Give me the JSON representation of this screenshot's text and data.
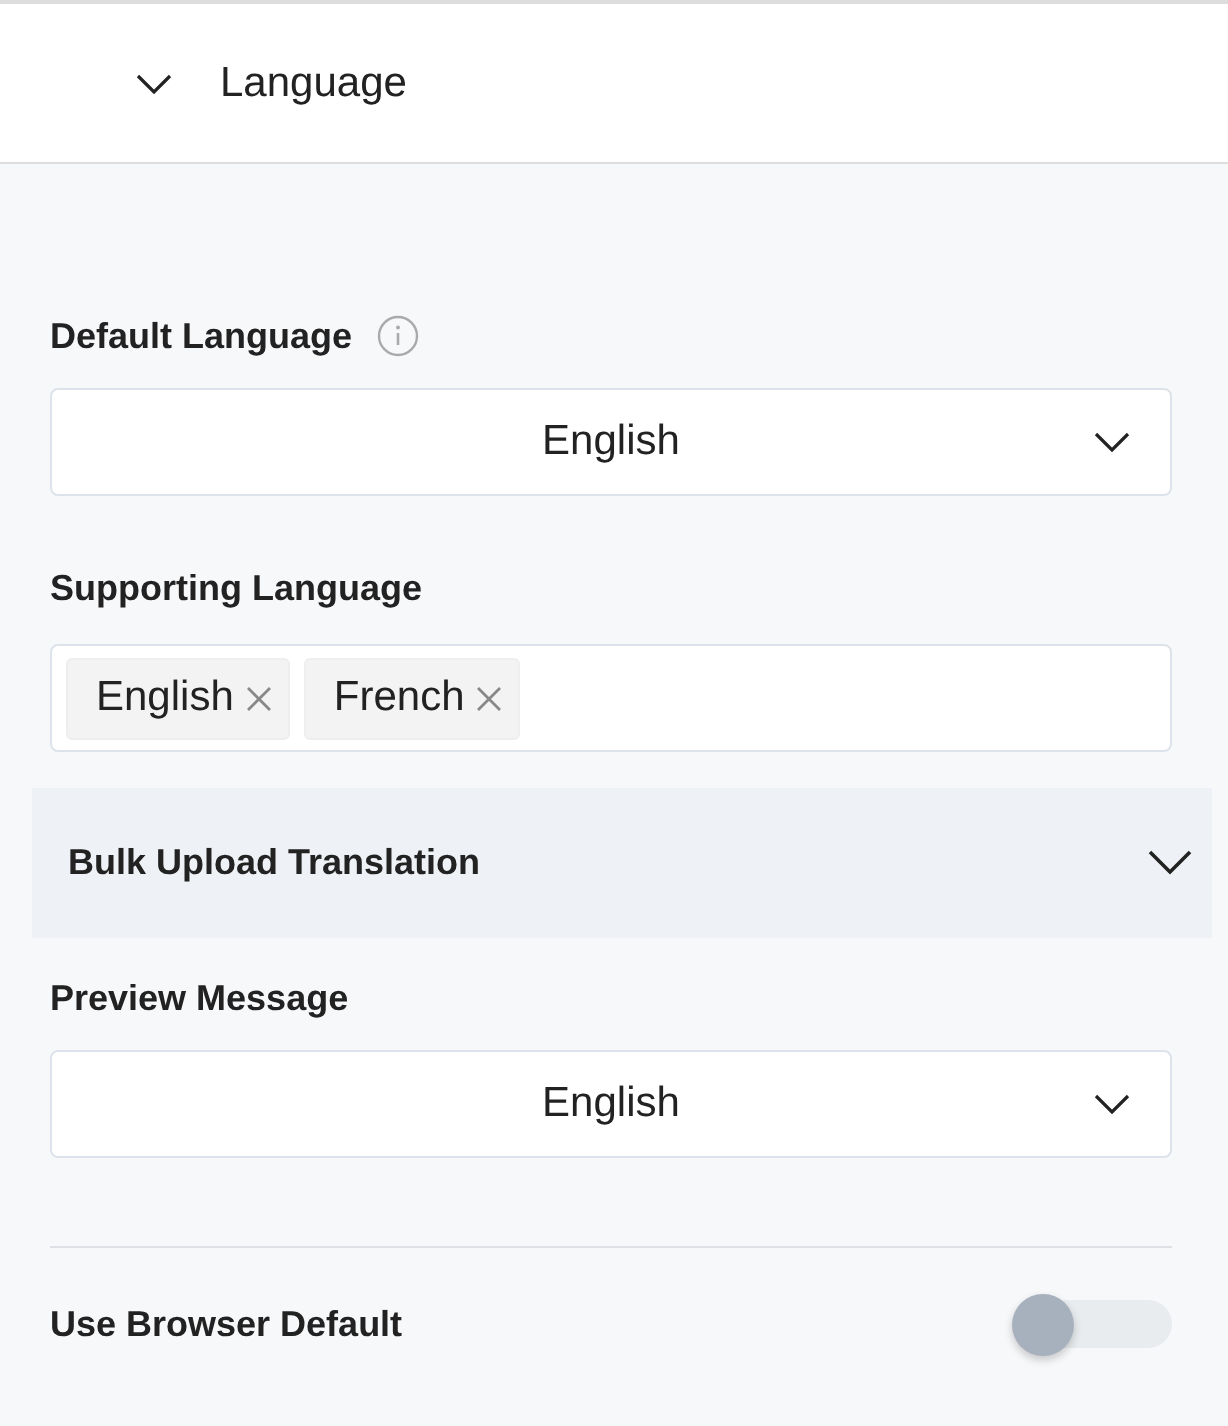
{
  "section": {
    "title": "Language",
    "expanded": true
  },
  "default_language": {
    "label": "Default Language",
    "value": "English"
  },
  "supporting_language": {
    "label": "Supporting Language",
    "tags": [
      "English",
      "French"
    ]
  },
  "bulk_upload": {
    "label": "Bulk Upload Translation",
    "expanded": false
  },
  "preview_message": {
    "label": "Preview Message",
    "value": "English"
  },
  "use_browser_default": {
    "label": "Use Browser Default",
    "on": false
  }
}
